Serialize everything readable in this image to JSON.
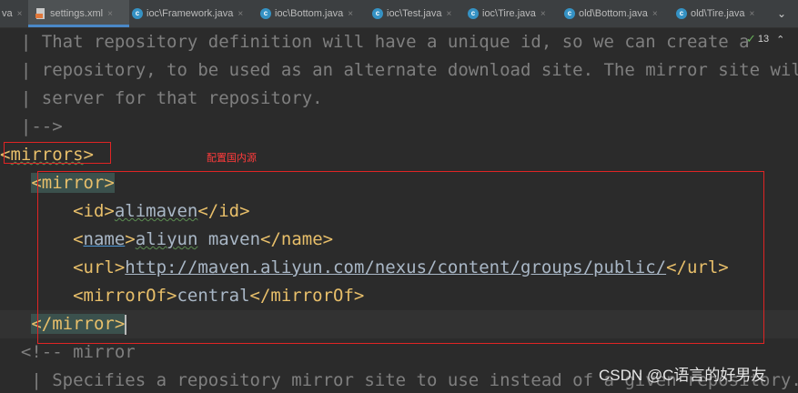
{
  "tabs": [
    {
      "label": "va",
      "kind": "partial"
    },
    {
      "label": "settings.xml",
      "kind": "xml",
      "active": true
    },
    {
      "label": "ioc\\Framework.java",
      "kind": "java"
    },
    {
      "label": "ioc\\Bottom.java",
      "kind": "java"
    },
    {
      "label": "ioc\\Test.java",
      "kind": "java"
    },
    {
      "label": "ioc\\Tire.java",
      "kind": "java"
    },
    {
      "label": "old\\Bottom.java",
      "kind": "java"
    },
    {
      "label": "old\\Tire.java",
      "kind": "java"
    }
  ],
  "icons": {
    "close": "×",
    "chevron": "⌄",
    "java_letter": "c",
    "check": "✓",
    "up": "⌃"
  },
  "inspection": {
    "count": "13"
  },
  "code": {
    "l1": "  | That repository definition will have a unique id, so we can create a",
    "l2": "  | repository, to be used as an alternate download site. The mirror site will",
    "l3": "  | server for that repository.",
    "l4": "  |-->",
    "l5_open": "<",
    "l5_name": "mirrors",
    "l5_close": ">",
    "l6_indent": "   ",
    "l6_tag": "<mirror>",
    "l7_indent": "       ",
    "l7_open": "<id>",
    "l7_val": "alimaven",
    "l7_close": "</id>",
    "l8_indent": "       ",
    "l8_lt": "<",
    "l8_name": "name",
    "l8_gt": ">",
    "l8_val1": "aliyun",
    "l8_val2": " maven",
    "l8_close": "</name>",
    "l9_indent": "       ",
    "l9_open": "<url>",
    "l9_val": "http://maven.aliyun.com/nexus/content/groups/public/",
    "l9_close": "</url>",
    "l10_indent": "       ",
    "l10_open": "<mirrorOf>",
    "l10_val": "central",
    "l10_close": "</mirrorOf>",
    "l11_indent": "   ",
    "l11_tag": "</mirror>",
    "l12": "  <!-- mirror",
    "l13": "   | Specifies a repository mirror site to use instead of a given repository."
  },
  "annotation": "配置国内源",
  "watermark": "CSDN @C语言的好男友",
  "colors": {
    "background": "#2b2b2b",
    "tag": "#e8bf6a",
    "text": "#a9b7c6",
    "comment": "#7f7f7f",
    "annotation": "#e02424"
  }
}
